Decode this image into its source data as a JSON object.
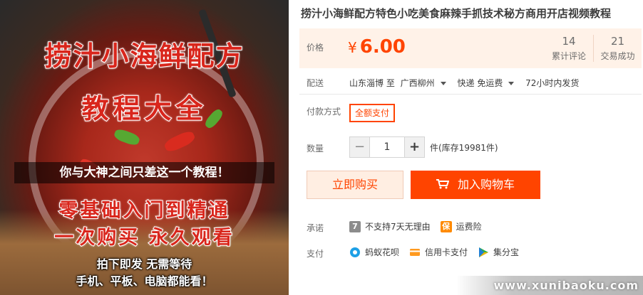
{
  "product_image": {
    "headline_1": "捞汁小海鲜配方",
    "headline_2": "教程大全",
    "tagline": "你与大神之间只差这一个教程！",
    "slogan_1": "零基础入门到精通",
    "slogan_2": "一次购买  永久观看",
    "note_1": "拍下即发  无需等待",
    "note_2": "手机、平板、电脑都能看！"
  },
  "product": {
    "title": "捞汁小海鲜配方特色小吃美食麻辣手抓技术秘方商用开店视频教程"
  },
  "price": {
    "label": "价格",
    "currency": "¥",
    "amount": "6.00",
    "reviews_count": "14",
    "reviews_label": "累计评论",
    "sales_count": "21",
    "sales_label": "交易成功",
    "accent_color": "#ff4400"
  },
  "shipping": {
    "label": "配送",
    "from": "山东淄博 至",
    "to": "广西柳州",
    "method": "快递 免运费",
    "dispatch": "72小时内发货"
  },
  "payment_method": {
    "label": "付款方式",
    "option": "全额支付"
  },
  "quantity": {
    "label": "数量",
    "minus": "−",
    "value": "1",
    "plus": "+",
    "stock": "件(库存19981件)"
  },
  "actions": {
    "buy_now": "立即购买",
    "add_to_cart": "加入购物车"
  },
  "promise": {
    "label": "承诺",
    "no_reason_icon": "7",
    "no_reason": "不支持7天无理由",
    "insurance_icon": "保",
    "insurance": "运费险"
  },
  "payments": {
    "label": "支付",
    "items": [
      {
        "icon": "huabei-icon",
        "text": "蚂蚁花呗"
      },
      {
        "icon": "credit-card-icon",
        "text": "信用卡支付"
      },
      {
        "icon": "jifenbao-icon",
        "text": "集分宝"
      }
    ]
  },
  "watermark": "www.xunibaoku.com"
}
